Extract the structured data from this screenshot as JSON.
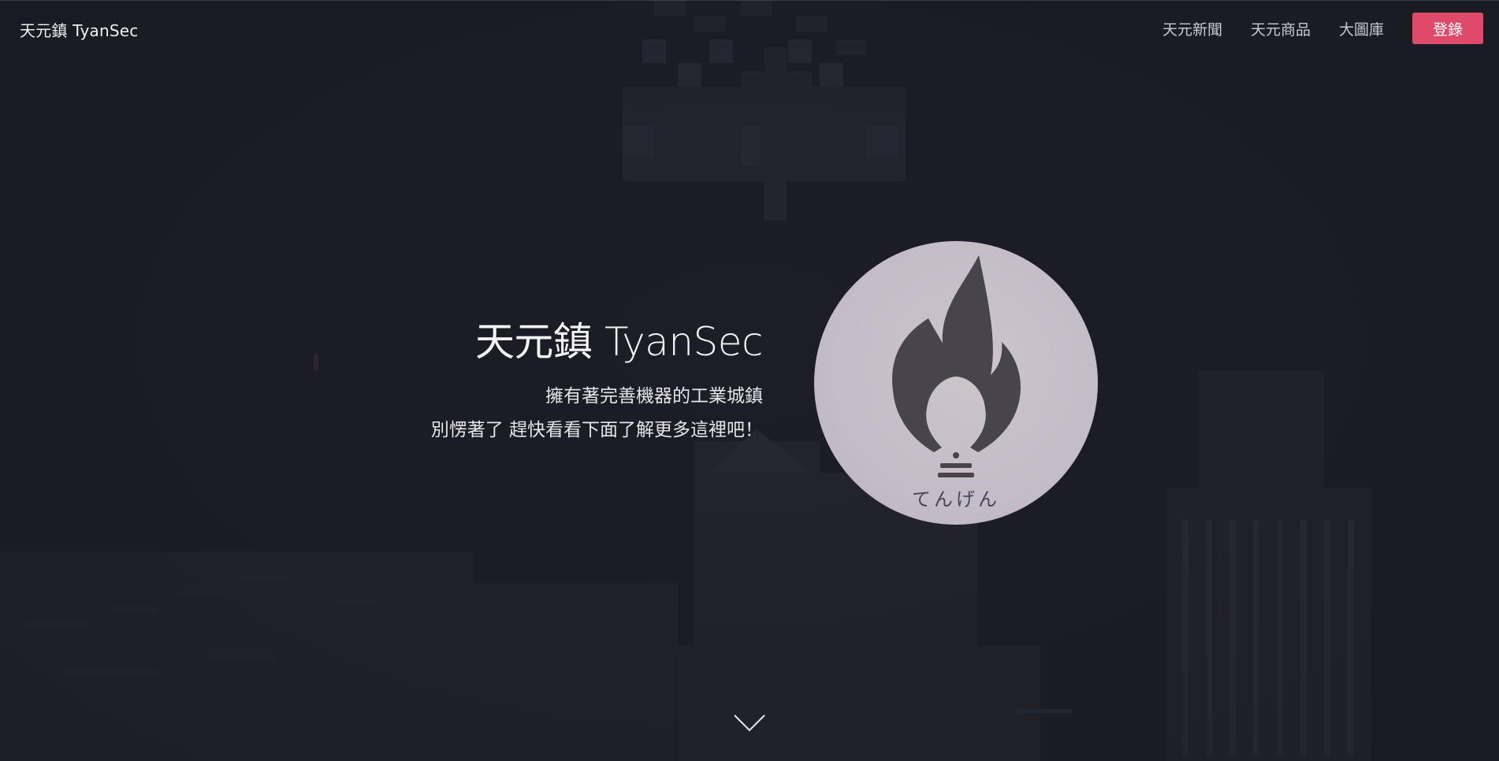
{
  "header": {
    "brand": "天元鎮 TyanSec",
    "nav": [
      {
        "label": "天元新聞"
      },
      {
        "label": "天元商品"
      },
      {
        "label": "大圖庫"
      }
    ],
    "login_label": "登錄"
  },
  "hero": {
    "title": "天元鎮 TyanSec",
    "line1": "擁有著完善機器的工業城鎮",
    "line2": "別愣著了 趕快看看下面了解更多這裡吧！",
    "logo_caption": "てんげん"
  },
  "icons": {
    "logo": "flame-bulb-logo-icon",
    "scroll": "chevron-down-icon"
  },
  "colors": {
    "background": "#1c1d25",
    "accent": "#e04a6a",
    "logo_fill": "#48444c"
  }
}
